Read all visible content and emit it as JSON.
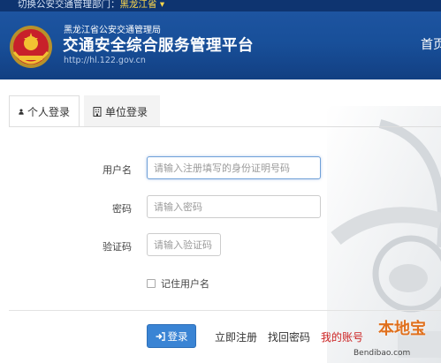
{
  "header": {
    "topbar_text": "切换公安交通管理部门：",
    "topbar_region": "黑龙江省 ▾",
    "org_name": "黑龙江省公安交通管理局",
    "platform_title": "交通安全综合服务管理平台",
    "site_url": "http://hl.122.gov.cn",
    "nav_home": "首页"
  },
  "tabs": [
    {
      "label": "个人登录",
      "icon": "user-icon",
      "active": true
    },
    {
      "label": "单位登录",
      "icon": "building-icon",
      "active": false
    }
  ],
  "form": {
    "username_label": "用户名",
    "username_placeholder": "请输入注册填写的身份证明号码",
    "password_label": "密码",
    "password_placeholder": "请输入密码",
    "captcha_label": "验证码",
    "captcha_placeholder": "请输入验证码",
    "remember_label": "记住用户名",
    "remember_checked": false
  },
  "actions": {
    "login_label": "登录",
    "register_label": "立即注册",
    "recover_label": "找回密码",
    "account_label": "我的账号"
  },
  "watermark": {
    "logo_text": "本地宝",
    "url_text": "Bendibao.com"
  },
  "colors": {
    "header_blue": "#184f99",
    "login_button": "#3a84d4",
    "account_link_red": "#cc2222",
    "region_yellow": "#ffd84a"
  }
}
